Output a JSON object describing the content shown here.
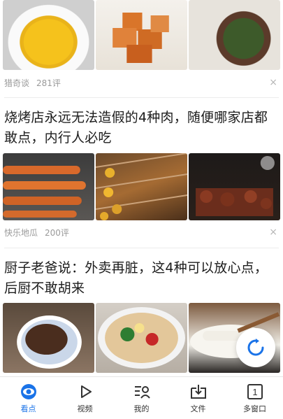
{
  "articles": [
    {
      "title": "",
      "source": "猎奇谈",
      "comments": "281评",
      "images": [
        "food-plate-yellow",
        "fried-tofu",
        "wild-greens"
      ]
    },
    {
      "title": "烧烤店永远无法造假的4种肉，随便哪家店都敢点，内行人必吃",
      "source": "快乐地瓜",
      "comments": "200评",
      "images": [
        "grilled-shrimp-skewers",
        "bbq-skewers",
        "bbq-grill"
      ]
    },
    {
      "title": "厨子老爸说：外卖再脏，这4种可以放心点，后厨不敢胡来",
      "source": "",
      "comments": "",
      "images": [
        "rice-bowl-topping",
        "noodles-bowl",
        "porridge-spoon"
      ]
    }
  ],
  "close_icon": "×",
  "tabs": [
    {
      "label": "看点",
      "icon": "eye-icon",
      "active": true
    },
    {
      "label": "视频",
      "icon": "play-icon",
      "active": false
    },
    {
      "label": "我的",
      "icon": "profile-list-icon",
      "active": false
    },
    {
      "label": "文件",
      "icon": "download-icon",
      "active": false
    },
    {
      "label": "多窗口",
      "icon": "window-count-icon",
      "window_count": "1",
      "active": false
    }
  ],
  "colors": {
    "accent": "#1a73e8",
    "meta": "#9a9a9a"
  }
}
